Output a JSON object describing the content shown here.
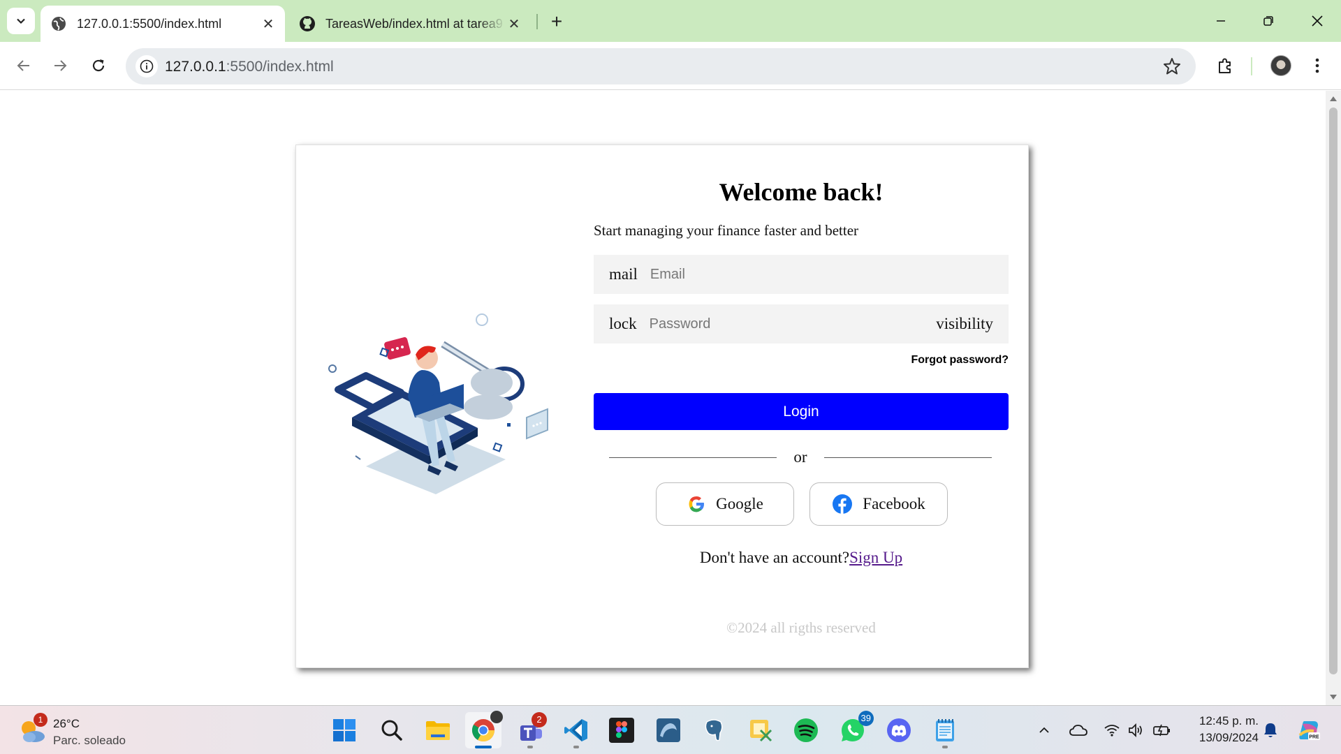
{
  "browser": {
    "tabs": [
      {
        "title": "127.0.0.1:5500/index.html",
        "active": true,
        "favicon": "globe-icon"
      },
      {
        "title": "TareasWeb/index.html at tarea9",
        "active": false,
        "favicon": "github-icon"
      }
    ],
    "url_host": "127.0.0.1",
    "url_path": ":5500/index.html",
    "accent_color": "#cbeabf"
  },
  "login": {
    "welcome": "Welcome back!",
    "subtitle": "Start managing your finance faster and better",
    "email_icon_text": "mail",
    "email_placeholder": "Email",
    "password_icon_text": "lock",
    "password_placeholder": "Password",
    "visibility_text": "visibility",
    "forgot": "Forgot password?",
    "login_button": "Login",
    "or": "or",
    "google": "Google",
    "facebook": "Facebook",
    "no_account": "Don't have an account?",
    "sign_up": "Sign Up",
    "copyright": "©2024 all rigths reserved",
    "button_color": "#0000ff"
  },
  "taskbar": {
    "weather_badge": "1",
    "temperature": "26°C",
    "condition": "Parc. soleado",
    "apps": [
      {
        "name": "windows-start-icon"
      },
      {
        "name": "search-icon"
      },
      {
        "name": "file-explorer-icon"
      },
      {
        "name": "chrome-icon",
        "active": true
      },
      {
        "name": "teams-icon",
        "badge": "2"
      },
      {
        "name": "vscode-icon"
      },
      {
        "name": "figma-icon"
      },
      {
        "name": "mysql-workbench-icon"
      },
      {
        "name": "postgresql-icon"
      },
      {
        "name": "snipping-tool-icon"
      },
      {
        "name": "spotify-icon"
      },
      {
        "name": "whatsapp-icon",
        "badge": "39"
      },
      {
        "name": "discord-icon"
      },
      {
        "name": "notepad-icon"
      }
    ],
    "time": "12:45 p. m.",
    "date": "13/09/2024"
  }
}
